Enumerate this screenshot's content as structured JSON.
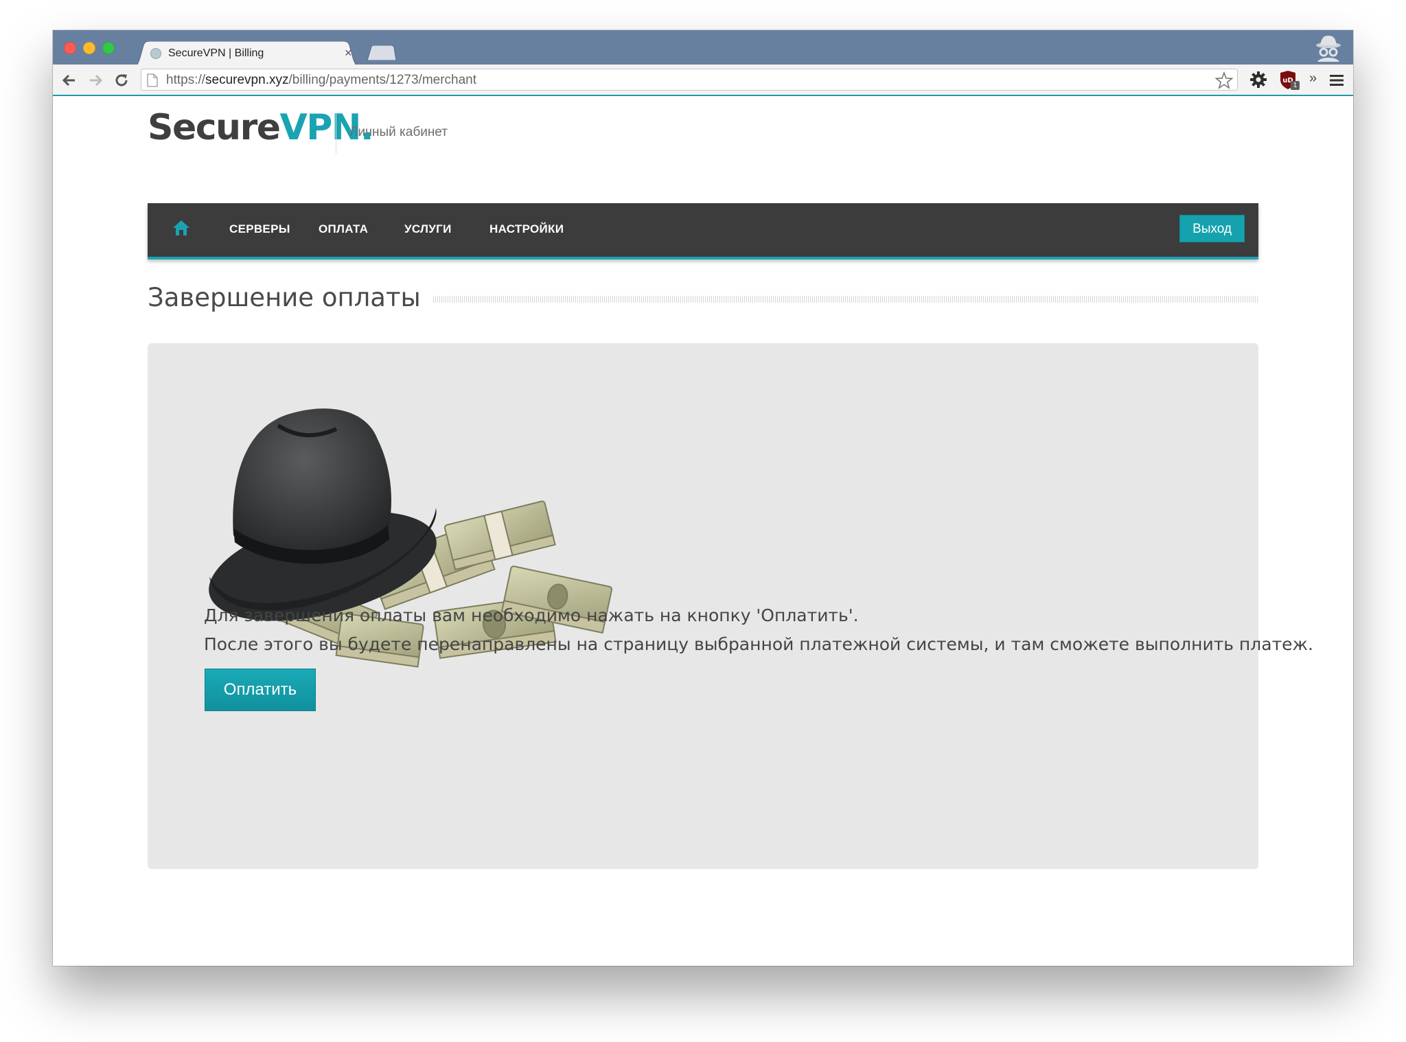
{
  "browser": {
    "tab_title": "SecureVPN | Billing",
    "tab_close": "×",
    "url_scheme": "https://",
    "url_domain": "securevpn.xyz",
    "url_path": "/billing/payments/1273/merchant",
    "extensions_overflow": "»",
    "ublock_badge": "1"
  },
  "header": {
    "logo_part1": "Secure",
    "logo_part2": "VPN.",
    "subtitle": "Личный кабинет"
  },
  "nav": {
    "items": [
      "СЕРВЕРЫ",
      "ОПЛАТА",
      "УСЛУГИ",
      "НАСТРОЙКИ"
    ],
    "logout_label": "Выход"
  },
  "main": {
    "title": "Завершение оплаты",
    "line1": "Для завершения оплаты вам необходимо нажать на кнопку 'Оплатить'.",
    "line2": "После этого вы будете перенаправлены на страницу выбранной платежной системы, и там сможете выполнить платеж.",
    "pay_button_label": "Оплатить",
    "illustration": "fedora-hat-on-money-stacks"
  },
  "colors": {
    "accent": "#1aa3b2",
    "navbar": "#3c3c3c",
    "panel": "#e7e7e7",
    "tabstrip": "#6880a0"
  }
}
